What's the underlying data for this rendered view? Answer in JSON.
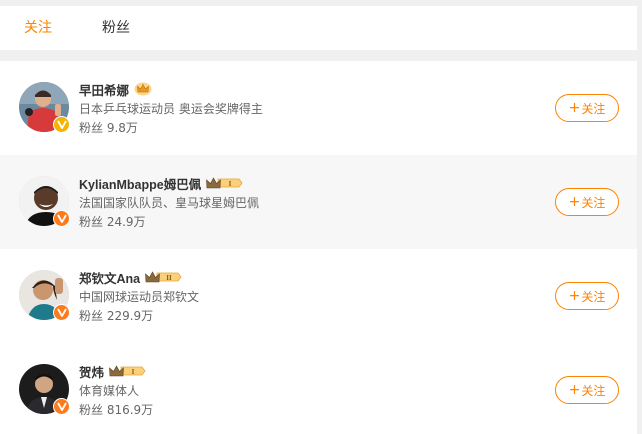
{
  "tabs": {
    "follow": "关注",
    "fans": "粉丝"
  },
  "colors": {
    "accent": "#ff8200",
    "alt_row": "#f7f7f7"
  },
  "users": [
    {
      "name": "早田希娜",
      "crown_level": "",
      "description": "日本乒乓球运动员 奥运会奖牌得主",
      "fans": "粉丝 9.8万",
      "badge": "gold-v-icon",
      "follow_label": "关注"
    },
    {
      "name": "KylianMbappe姆巴佩",
      "crown_level": "I",
      "description": "法国国家队队员、皇马球星姆巴佩",
      "fans": "粉丝 24.9万",
      "badge": "orange-v-icon",
      "follow_label": "关注"
    },
    {
      "name": "郑钦文Ana",
      "crown_level": "II",
      "description": "中国网球运动员郑钦文",
      "fans": "粉丝 229.9万",
      "badge": "orange-v-icon",
      "follow_label": "关注"
    },
    {
      "name": "贺炜",
      "crown_level": "I",
      "description": "体育媒体人",
      "fans": "粉丝 816.9万",
      "badge": "orange-v-icon",
      "follow_label": "关注"
    }
  ]
}
